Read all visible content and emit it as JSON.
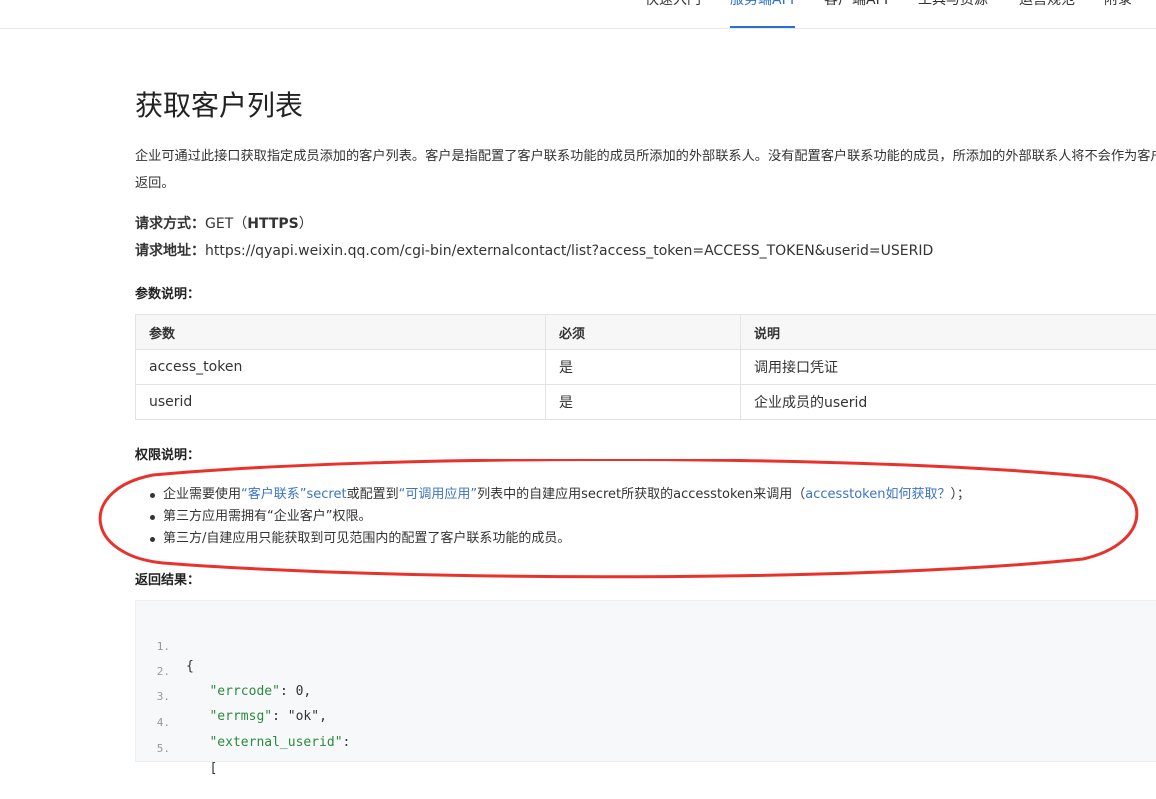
{
  "nav": {
    "tabs": [
      "快速入门",
      "服务端API",
      "客户端API",
      "工具与资源",
      "运营规范",
      "附录"
    ],
    "active_index": 1,
    "accent_color": "#2b6fd6"
  },
  "page": {
    "title": "获取客户列表",
    "intro": "企业可通过此接口获取指定成员添加的客户列表。客户是指配置了客户联系功能的成员所添加的外部联系人。没有配置客户联系功能的成员，所添加的外部联系人将不会作为客户返回。",
    "request_method_label": "请求方式：",
    "request_method_value": "GET（",
    "request_method_protocol": "HTTPS",
    "request_method_close": "）",
    "request_url_label": "请求地址：",
    "request_url_value": "https://qyapi.weixin.qq.com/cgi-bin/externalcontact/list?access_token=ACCESS_TOKEN&userid=USERID"
  },
  "params_section": {
    "label": "参数说明：",
    "headers": [
      "参数",
      "必须",
      "说明"
    ],
    "rows": [
      [
        "access_token",
        "是",
        "调用接口凭证"
      ],
      [
        "userid",
        "是",
        "企业成员的userid"
      ]
    ]
  },
  "permission_section": {
    "label": "权限说明：",
    "item1": {
      "p1": "企业需要使用",
      "link1": "“客户联系”secret",
      "p2": "或配置到",
      "link2": "“可调用应用”",
      "p3": "列表中的自建应用secret所获取的accesstoken来调用（",
      "link3": "accesstoken如何获取？",
      "p4": "）；"
    },
    "item2": "第三方应用需拥有“企业客户”权限。",
    "item3": "第三方/自建应用只能获取到可见范围内的配置了客户联系功能的成员。"
  },
  "result_section": {
    "label": "返回结果：",
    "code_lines": [
      {
        "num": "1.",
        "indent": "",
        "key": "",
        "value": "{"
      },
      {
        "num": "2.",
        "indent": "   ",
        "key": "\"errcode\"",
        "value": ": 0,"
      },
      {
        "num": "3.",
        "indent": "   ",
        "key": "\"errmsg\"",
        "value": ": \"ok\","
      },
      {
        "num": "4.",
        "indent": "   ",
        "key": "\"external_userid\"",
        "value": ":"
      },
      {
        "num": "5.",
        "indent": "   ",
        "key": "",
        "value": "["
      }
    ]
  },
  "annotation": {
    "type": "red-ellipse",
    "color": "#e8322b"
  }
}
